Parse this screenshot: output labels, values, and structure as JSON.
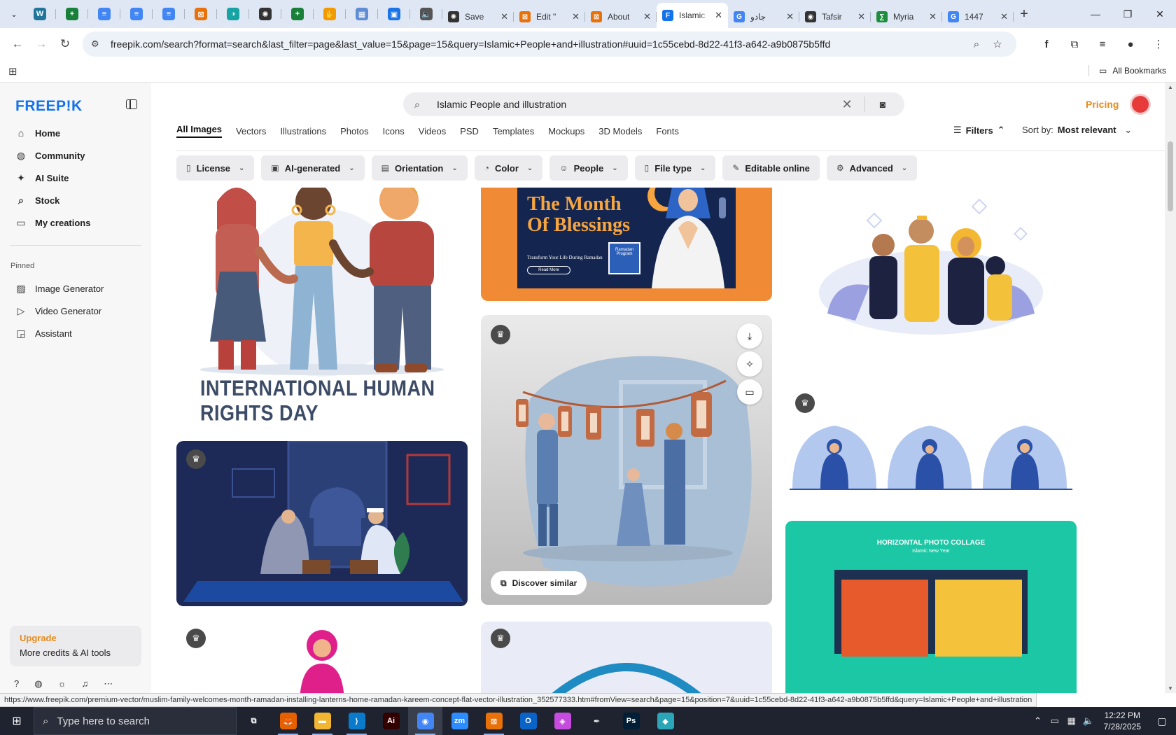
{
  "browser": {
    "pinned_tabs": [
      {
        "icon": "wordpress-icon",
        "color": "#21759b",
        "glyph": "W"
      },
      {
        "icon": "sheets-icon",
        "color": "#188038",
        "glyph": "+"
      },
      {
        "icon": "docs-icon",
        "color": "#4285f4",
        "glyph": "≡"
      },
      {
        "icon": "docs-icon",
        "color": "#4285f4",
        "glyph": "≡"
      },
      {
        "icon": "docs-icon",
        "color": "#4285f4",
        "glyph": "≡"
      },
      {
        "icon": "kinsta-icon",
        "color": "#e8710a",
        "glyph": "⊠"
      },
      {
        "icon": "arc-icon",
        "color": "#16a3a3",
        "glyph": "◑"
      },
      {
        "icon": "openai-icon",
        "color": "#333333",
        "glyph": "✺"
      },
      {
        "icon": "sheets-icon",
        "color": "#188038",
        "glyph": "+"
      },
      {
        "icon": "hand-icon",
        "color": "#f29900",
        "glyph": "✋"
      },
      {
        "icon": "grid-doc-icon",
        "color": "#5f8dd3",
        "glyph": "▦"
      },
      {
        "icon": "forms-icon",
        "color": "#1a73e8",
        "glyph": "▣"
      },
      {
        "icon": "speaker-icon",
        "color": "#555555",
        "glyph": "🔈"
      }
    ],
    "tabs": [
      {
        "title": "Save",
        "icon": "openai-icon",
        "color": "#333333",
        "glyph": "✺",
        "active": false
      },
      {
        "title": "Edit \"",
        "icon": "kinsta-icon",
        "color": "#e8710a",
        "glyph": "⊠",
        "active": false
      },
      {
        "title": "About",
        "icon": "kinsta-icon",
        "color": "#e8710a",
        "glyph": "⊠",
        "active": false
      },
      {
        "title": "Islamic",
        "icon": "freepik-icon",
        "color": "#1273eb",
        "glyph": "F",
        "active": true
      },
      {
        "title": "جادو",
        "icon": "google-icon",
        "color": "#4285f4",
        "glyph": "G",
        "active": false
      },
      {
        "title": "Tafsir",
        "icon": "tafsir-icon",
        "color": "#333333",
        "glyph": "◉",
        "active": false
      },
      {
        "title": "Myria",
        "icon": "myria-icon",
        "color": "#1e8e3e",
        "glyph": "∑",
        "active": false
      },
      {
        "title": "1447",
        "icon": "google-icon",
        "color": "#4285f4",
        "glyph": "G",
        "active": false
      }
    ],
    "url": "freepik.com/search?format=search&last_filter=page&last_value=15&page=15&query=Islamic+People+and+illustration#uuid=1c55cebd-8d22-41f3-a642-a9b0875b5ffd",
    "all_bookmarks": "All Bookmarks",
    "status_url": "https://www.freepik.com/premium-vector/muslim-family-welcomes-month-ramadan-installing-lanterns-home-ramadan-kareem-concept-flat-vector-illustration_352577333.htm#fromView=search&page=15&position=7&uuid=1c55cebd-8d22-41f3-a642-a9b0875b5ffd&query=Islamic+People+and+illustration"
  },
  "sidebar": {
    "logo": "FREEP!K",
    "nav": [
      {
        "label": "Home",
        "icon": "home-icon",
        "glyph": "⌂"
      },
      {
        "label": "Community",
        "icon": "globe-icon",
        "glyph": "◍"
      },
      {
        "label": "AI Suite",
        "icon": "sparkle-icon",
        "glyph": "✦"
      },
      {
        "label": "Stock",
        "icon": "search-icon",
        "glyph": "⌕"
      },
      {
        "label": "My creations",
        "icon": "folder-icon",
        "glyph": "▭"
      }
    ],
    "pinned_label": "Pinned",
    "pinned": [
      {
        "label": "Image Generator",
        "icon": "image-icon",
        "glyph": "▨"
      },
      {
        "label": "Video Generator",
        "icon": "video-icon",
        "glyph": "▷"
      },
      {
        "label": "Assistant",
        "icon": "chat-icon",
        "glyph": "◲"
      }
    ],
    "upgrade_title": "Upgrade",
    "upgrade_sub": "More credits & AI tools"
  },
  "header": {
    "search_query": "Islamic People and illustration",
    "pricing": "Pricing"
  },
  "categories": [
    "All Images",
    "Vectors",
    "Illustrations",
    "Photos",
    "Icons",
    "Videos",
    "PSD",
    "Templates",
    "Mockups",
    "3D Models",
    "Fonts"
  ],
  "filters_label": "Filters",
  "sort": {
    "label": "Sort by:",
    "value": "Most relevant"
  },
  "chips": [
    {
      "label": "License",
      "glyph": "▯"
    },
    {
      "label": "AI-generated",
      "glyph": "▣"
    },
    {
      "label": "Orientation",
      "glyph": "▤"
    },
    {
      "label": "Color",
      "glyph": "◔"
    },
    {
      "label": "People",
      "glyph": "☺"
    },
    {
      "label": "File type",
      "glyph": "▯"
    },
    {
      "label": "Editable online",
      "glyph": "✎"
    },
    {
      "label": "Advanced",
      "glyph": "⚙"
    }
  ],
  "results": {
    "human_rights_title": "INTERNATIONAL HUMAN RIGHTS DAY",
    "blessings_title_1": "The Month",
    "blessings_title_2": "Of Blessings",
    "blessings_sub": "Transform Your Life During Ramadan",
    "blessings_btn": "Read More",
    "blessings_badge": "Ramadan Program",
    "discover_similar": "Discover similar",
    "collage_title": "HORIZONTAL PHOTO COLLAGE",
    "collage_sub": "Islamic New Year"
  },
  "taskbar": {
    "search_placeholder": "Type here to search",
    "time": "12:22 PM",
    "date": "7/28/2025",
    "apps": [
      {
        "icon": "task-view-icon",
        "color": "transparent",
        "glyph": "⧉"
      },
      {
        "icon": "firefox-icon",
        "color": "#e66000",
        "glyph": "🦊"
      },
      {
        "icon": "file-explorer-icon",
        "color": "#f2b632",
        "glyph": "▬"
      },
      {
        "icon": "vscode-icon",
        "color": "#0a7acc",
        "glyph": "⟩"
      },
      {
        "icon": "illustrator-icon",
        "color": "#330000",
        "glyph": "Ai"
      },
      {
        "icon": "chrome-icon",
        "color": "#4285f4",
        "glyph": "◉"
      },
      {
        "icon": "zoom-icon",
        "color": "#2d8cff",
        "glyph": "zm"
      },
      {
        "icon": "kinsta-icon",
        "color": "#e8710a",
        "glyph": "⊠"
      },
      {
        "icon": "outlook-icon",
        "color": "#0a64c8",
        "glyph": "O"
      },
      {
        "icon": "affinity-icon",
        "color": "#c64ce0",
        "glyph": "◈"
      },
      {
        "icon": "pen-tool-icon",
        "color": "transparent",
        "glyph": "✒"
      },
      {
        "icon": "photoshop-icon",
        "color": "#001e36",
        "glyph": "Ps"
      },
      {
        "icon": "app-icon",
        "color": "#2aa6b8",
        "glyph": "◆"
      }
    ]
  }
}
